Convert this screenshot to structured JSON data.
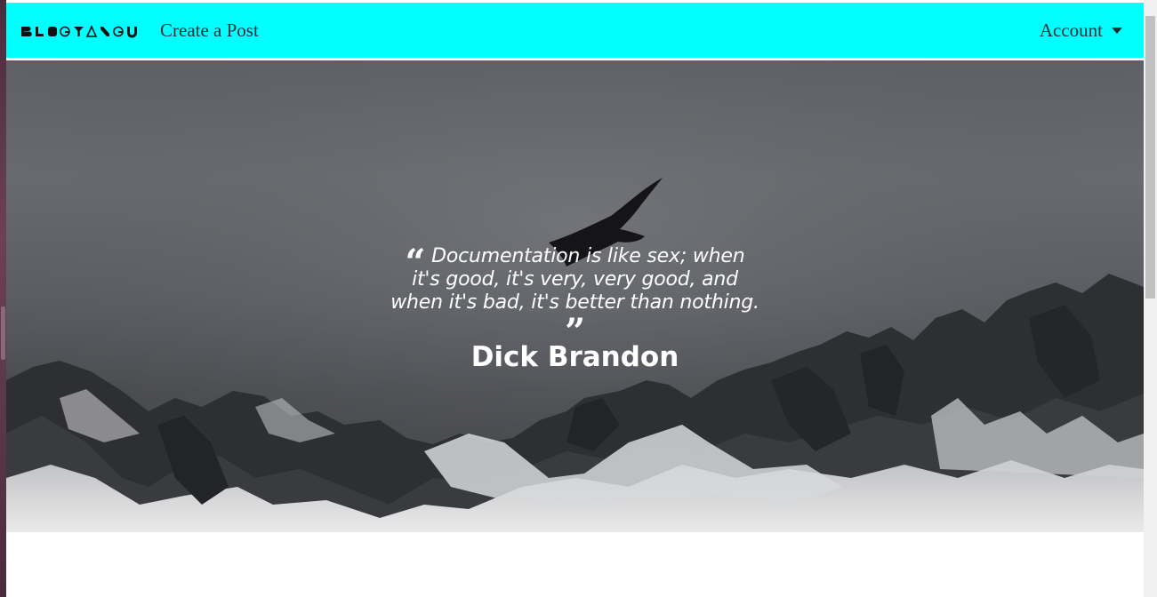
{
  "navbar": {
    "brand": "BLOGYANGU",
    "create_post": "Create a Post",
    "account": "Account",
    "background": "#00ffff"
  },
  "hero": {
    "quote": "Documentation is like sex; when it's good, it's very, very good, and when it's bad, it's better than nothing.",
    "author": "Dick Brandon",
    "open_quote": "“",
    "close_quote": "”"
  },
  "icons": {
    "account_caret": "caret-down-icon",
    "open_quote": "quote-open-icon",
    "close_quote": "quote-close-icon"
  }
}
